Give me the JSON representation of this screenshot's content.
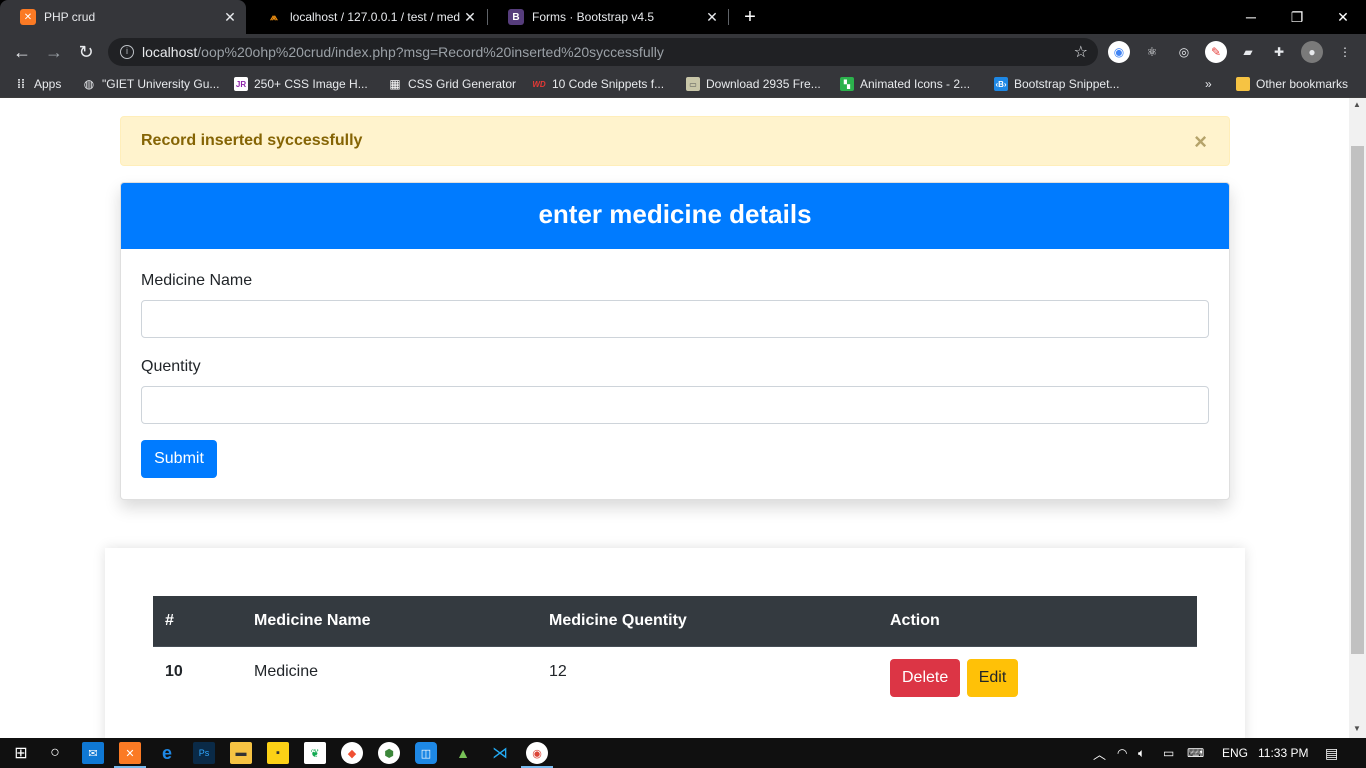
{
  "browser": {
    "tabs": [
      {
        "title": "PHP crud",
        "favicon": "xampp-icon",
        "active": true
      },
      {
        "title": "localhost / 127.0.0.1 / test / medi",
        "favicon": "phpmyadmin-icon",
        "active": false
      },
      {
        "title": "Forms · Bootstrap v4.5",
        "favicon": "bootstrap-icon",
        "active": false
      }
    ],
    "url_host": "localhost",
    "url_rest": "/oop%20ohp%20crud/index.php?msg=Record%20inserted%20syccessfully",
    "bookmarks": [
      {
        "label": "Apps",
        "icon": "apps-grid-icon"
      },
      {
        "label": "\"GIET University Gu...",
        "icon": "globe-icon"
      },
      {
        "label": "250+ CSS Image H...",
        "icon": "jr-icon"
      },
      {
        "label": "CSS Grid Generator",
        "icon": "grid-icon"
      },
      {
        "label": "10 Code Snippets f...",
        "icon": "wd-icon"
      },
      {
        "label": "Download 2935 Fre...",
        "icon": "image-icon"
      },
      {
        "label": "Animated Icons - 2...",
        "icon": "animated-icon"
      },
      {
        "label": "Bootstrap Snippet...",
        "icon": "bootstrap-snippet-icon"
      }
    ],
    "bookmarks_overflow": "»",
    "other_bookmarks": "Other bookmarks"
  },
  "alert": {
    "message": "Record inserted syccessfully",
    "close": "×",
    "color": "#856404"
  },
  "form": {
    "title": "enter medicine details",
    "name_label": "Medicine Name",
    "name_value": "",
    "quantity_label": "Quentity",
    "quantity_value": "",
    "submit_label": "Submit",
    "accent": "#007bff"
  },
  "table": {
    "headers": [
      "#",
      "Medicine Name",
      "Medicine Quentity",
      "Action"
    ],
    "rows": [
      {
        "id": "10",
        "name": "Medicine",
        "quantity": "12",
        "delete_label": "Delete",
        "edit_label": "Edit"
      }
    ]
  },
  "taskbar": {
    "apps": [
      "windows-start-icon",
      "cortana-icon",
      "mail-icon",
      "xampp-icon",
      "edge-icon",
      "photoshop-icon",
      "file-explorer-icon",
      "sticky-notes-icon",
      "mongodb-icon",
      "git-icon",
      "node-icon",
      "xd-icon",
      "android-icon",
      "vscode-icon",
      "chrome-icon"
    ],
    "language": "ENG",
    "time": "11:33 PM"
  }
}
